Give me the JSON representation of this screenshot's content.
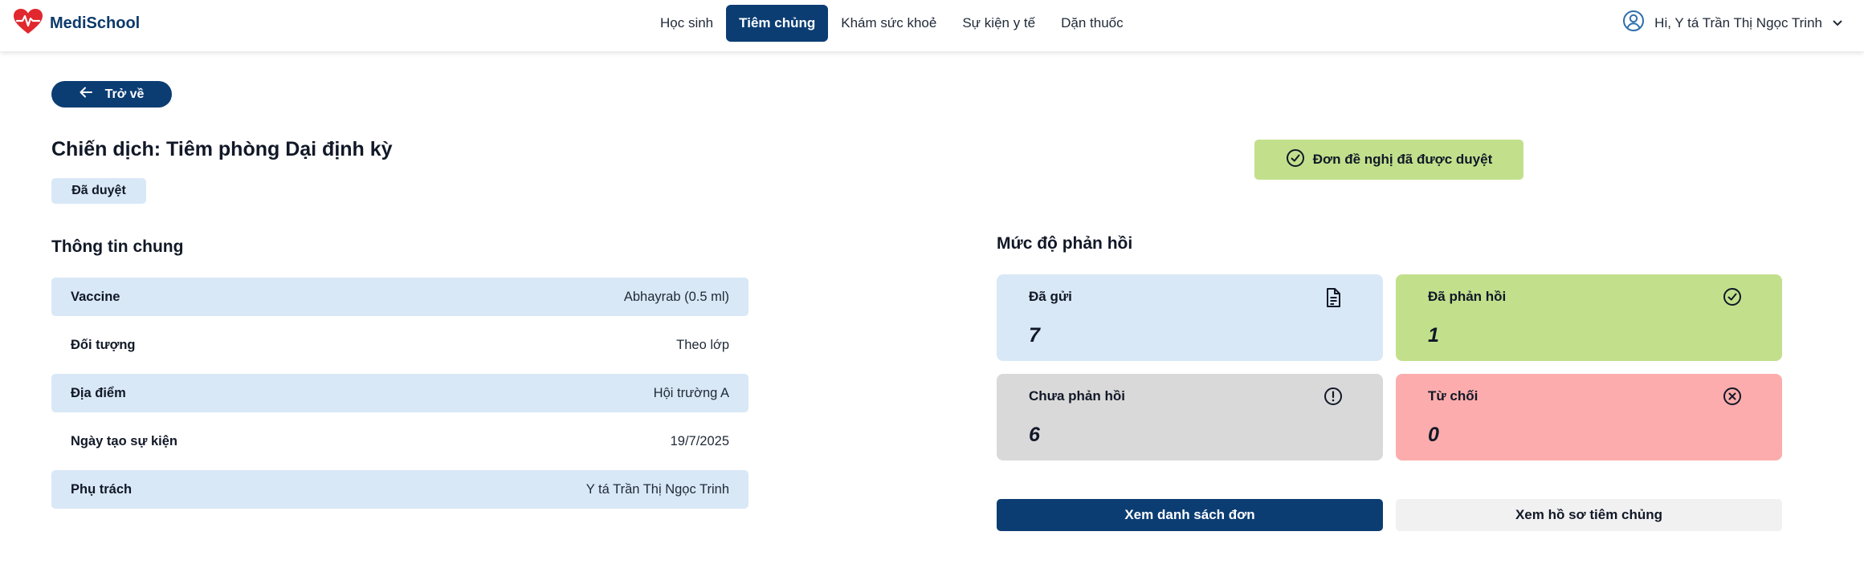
{
  "app": {
    "name": "MediSchool"
  },
  "nav": {
    "items": [
      {
        "label": "Học sinh"
      },
      {
        "label": "Tiêm chủng"
      },
      {
        "label": "Khám sức khoẻ"
      },
      {
        "label": "Sự kiện y tế"
      },
      {
        "label": "Dặn thuốc"
      }
    ],
    "active_index": 1
  },
  "user": {
    "greeting": "Hi, Y tá Trần Thị Ngọc Trinh"
  },
  "back_button": {
    "label": "Trở về"
  },
  "campaign": {
    "title": "Chiến dịch: Tiêm phòng Dại định kỳ",
    "status": "Đã duyệt",
    "approval_banner": "Đơn đề nghị đã được duyệt"
  },
  "general_info": {
    "title": "Thông tin chung",
    "rows": [
      {
        "label": "Vaccine",
        "value": "Abhayrab (0.5 ml)"
      },
      {
        "label": "Đối tượng",
        "value": "Theo lớp"
      },
      {
        "label": "Địa điểm",
        "value": "Hội trường A"
      },
      {
        "label": "Ngày tạo sự kiện",
        "value": "19/7/2025"
      },
      {
        "label": "Phụ trách",
        "value": "Y tá Trần Thị Ngọc Trinh"
      }
    ]
  },
  "response": {
    "title": "Mức độ phản hồi",
    "cards": [
      {
        "label": "Đã gửi",
        "value": "7",
        "icon": "document-icon",
        "color": "#d9e8f6"
      },
      {
        "label": "Đã phản hồi",
        "value": "1",
        "icon": "check-circle-icon",
        "color": "#c2e08c"
      },
      {
        "label": "Chưa phản hồi",
        "value": "6",
        "icon": "alert-circle-icon",
        "color": "#d9d9d9"
      },
      {
        "label": "Từ chối",
        "value": "0",
        "icon": "x-circle-icon",
        "color": "#fcacac"
      }
    ]
  },
  "actions": {
    "view_forms": "Xem danh sách đơn",
    "view_records": "Xem hồ sơ tiêm chủng"
  },
  "colors": {
    "primary": "#0b3d73",
    "light_blue": "#d9e8f6",
    "green": "#c2e08c",
    "gray": "#d9d9d9",
    "red": "#fcacac",
    "heart": "#e0282e"
  }
}
